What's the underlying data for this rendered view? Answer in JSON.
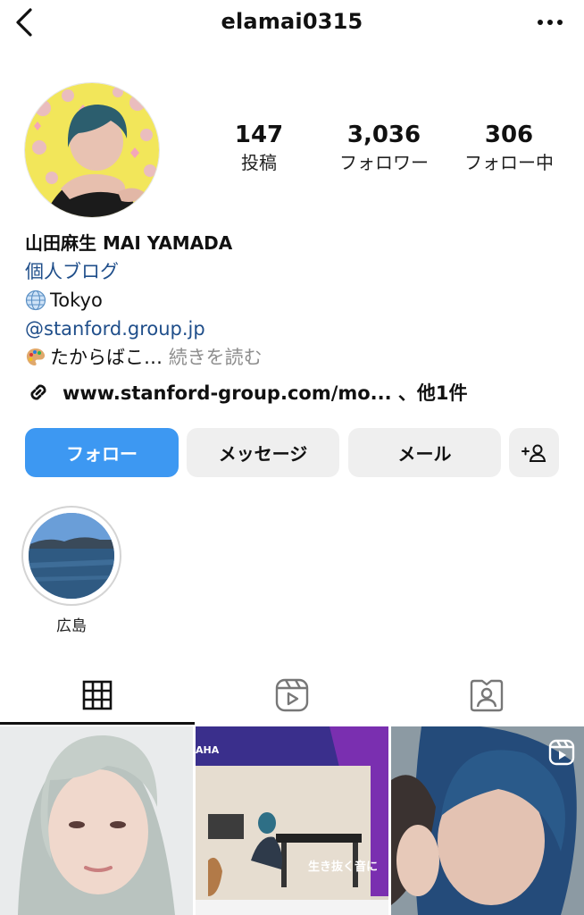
{
  "header": {
    "username": "elamai0315",
    "back_icon": "chevron-left-icon",
    "more_icon": "more-horizontal-icon"
  },
  "profile": {
    "stats": [
      {
        "value": "147",
        "label": "投稿"
      },
      {
        "value": "3,036",
        "label": "フォロワー"
      },
      {
        "value": "306",
        "label": "フォロー中"
      }
    ],
    "name": "山田麻生 MAI YAMADA",
    "category": "個人ブログ",
    "location": "Tokyo",
    "mention": "@stanford.group.jp",
    "bio_snippet": "たからばこ…",
    "bio_more": "続きを読む",
    "external_link": "www.stanford-group.com/mo... 、他1件"
  },
  "actions": {
    "follow": "フォロー",
    "message": "メッセージ",
    "mail": "メール"
  },
  "highlights": [
    {
      "label": "広島"
    }
  ],
  "tabs": [
    "posts-grid",
    "reels",
    "tagged"
  ],
  "grid_overlay": {
    "post2_brand": "AHA",
    "post2_caption": "生き抜く音に"
  },
  "colors": {
    "follow_button": "#3d98f2",
    "secondary_button": "#efefef",
    "link": "#1f4e8a",
    "muted": "#8e8e8e"
  }
}
